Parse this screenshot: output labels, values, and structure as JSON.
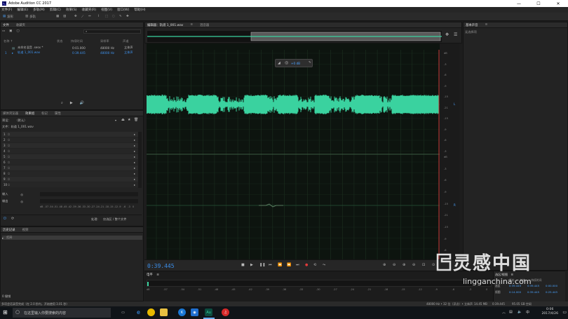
{
  "window": {
    "title": "Adobe Audition CC 2017"
  },
  "menu": [
    "文件(F)",
    "编辑(E)",
    "多轨(M)",
    "剪辑(C)",
    "效果(S)",
    "收藏夹(R)",
    "视图(V)",
    "窗口(W)",
    "帮助(H)"
  ],
  "toolbar": {
    "waveform": "波形",
    "multitrack": "多轨"
  },
  "workspaces": {
    "default": "默认",
    "edit_audio_video": "编辑音频到视频",
    "radio": "无线电作品"
  },
  "search": {
    "placeholder": "搜索帮助"
  },
  "files_panel": {
    "tabs": [
      "文件",
      "收藏夹"
    ],
    "columns": {
      "name": "名称 ↑",
      "status": "状态",
      "duration": "持续时间",
      "sample_rate": "采样率",
      "channels": "声道"
    },
    "rows": [
      {
        "idx": "",
        "name": "未命名混音 .sesx *",
        "duration": "0:01.000",
        "rate": "48000 Hz",
        "ch": "立体声"
      },
      {
        "idx": "1",
        "name": "轨道 1_001.wav",
        "duration": "0:39.445",
        "rate": "48000 Hz",
        "ch": "立体声"
      }
    ]
  },
  "effects_panel": {
    "tabs": [
      "媒体浏览器",
      "效果组",
      "标记",
      "属性"
    ],
    "preset_label": "预设：",
    "preset_value": "（默认）",
    "file_label": "文件：轨道 1_001.wav",
    "slots": [
      "1",
      "2",
      "3",
      "4",
      "5",
      "6",
      "7",
      "8",
      "9",
      "10"
    ],
    "in_label": "输入",
    "out_label": "输出",
    "db_ticks": [
      "dB",
      "-57",
      "-54",
      "-51",
      "-48",
      "-45",
      "-42",
      "-39",
      "-36",
      "-33",
      "-30",
      "-27",
      "-24",
      "-21",
      "-18",
      "-15",
      "-12",
      "-9",
      "-6",
      "-3",
      "0"
    ],
    "process_label": "处理:",
    "process_value": "仅选区 / 整个文件"
  },
  "history_panel": {
    "tabs": [
      "历史记录",
      "视频"
    ],
    "items": [
      "打开"
    ],
    "undo_count": "0 撤销"
  },
  "editor": {
    "tabs": [
      "编辑器：轨道 1_001.wav",
      "混音器"
    ],
    "time_label": "hms",
    "ruler_ticks": [
      "15.0",
      "16.0",
      "17.0",
      "18.0",
      "19.0",
      "20.0",
      "21.0",
      "22.0",
      "23.0",
      "24.0",
      "25.0",
      "26.0",
      "27.0",
      "28.0",
      "29.0",
      "30.0",
      "31.0",
      "32.0",
      "33.0",
      "34.0",
      "35.0",
      "36.0",
      "37.0",
      "38.0"
    ],
    "hud_value": "+0 dB",
    "db_top": [
      "dB",
      "-3",
      "-6",
      "-9",
      "-15",
      "-21",
      "-15",
      "-9",
      "-6",
      "-3"
    ],
    "db_bottom": [
      "dB",
      "-3",
      "-6",
      "-9",
      "-15",
      "-21",
      "-15",
      "-9",
      "-6",
      "-3"
    ],
    "channel_top": "L",
    "channel_bottom": "R",
    "waveform_color": "#3ad29f"
  },
  "transport": {
    "timecode": "0:39.445"
  },
  "essential_sound": {
    "title": "基本声音",
    "subtitle": "无选择项"
  },
  "levels": {
    "title": "电平",
    "ticks": [
      "dB",
      "-57",
      "-54",
      "-51",
      "-48",
      "-45",
      "-42",
      "-39",
      "-36",
      "-33",
      "-30",
      "-27",
      "-24",
      "-21",
      "-18",
      "-15",
      "-12",
      "-9",
      "-6",
      "-3",
      "0"
    ]
  },
  "selection": {
    "title": "选区/视图",
    "headers": [
      "开始",
      "结束",
      "持续时间"
    ],
    "rows": [
      {
        "label": "选区",
        "start": "0:39.445",
        "end": "0:39.445",
        "dur": "0:00.000"
      },
      {
        "label": "视图",
        "start": "0:14.000",
        "end": "0:39.445",
        "dur": "0:25.445"
      }
    ]
  },
  "status": {
    "left": "多项会话录音完成（在 2.0 秒内，开始使用 3.01 秒）",
    "sample": "48000 Hz • 32 位（浮点）• 立体声",
    "size": "14.45 MB",
    "dur": "0:39.445",
    "free": "95.05 GB 空闲"
  },
  "taskbar": {
    "search_text": "在这里输入你要搜索的内容",
    "time": "0:06",
    "date": "2017/4/26"
  },
  "watermark": {
    "cn": "灵感中国",
    "url": "lingganchina.com"
  }
}
